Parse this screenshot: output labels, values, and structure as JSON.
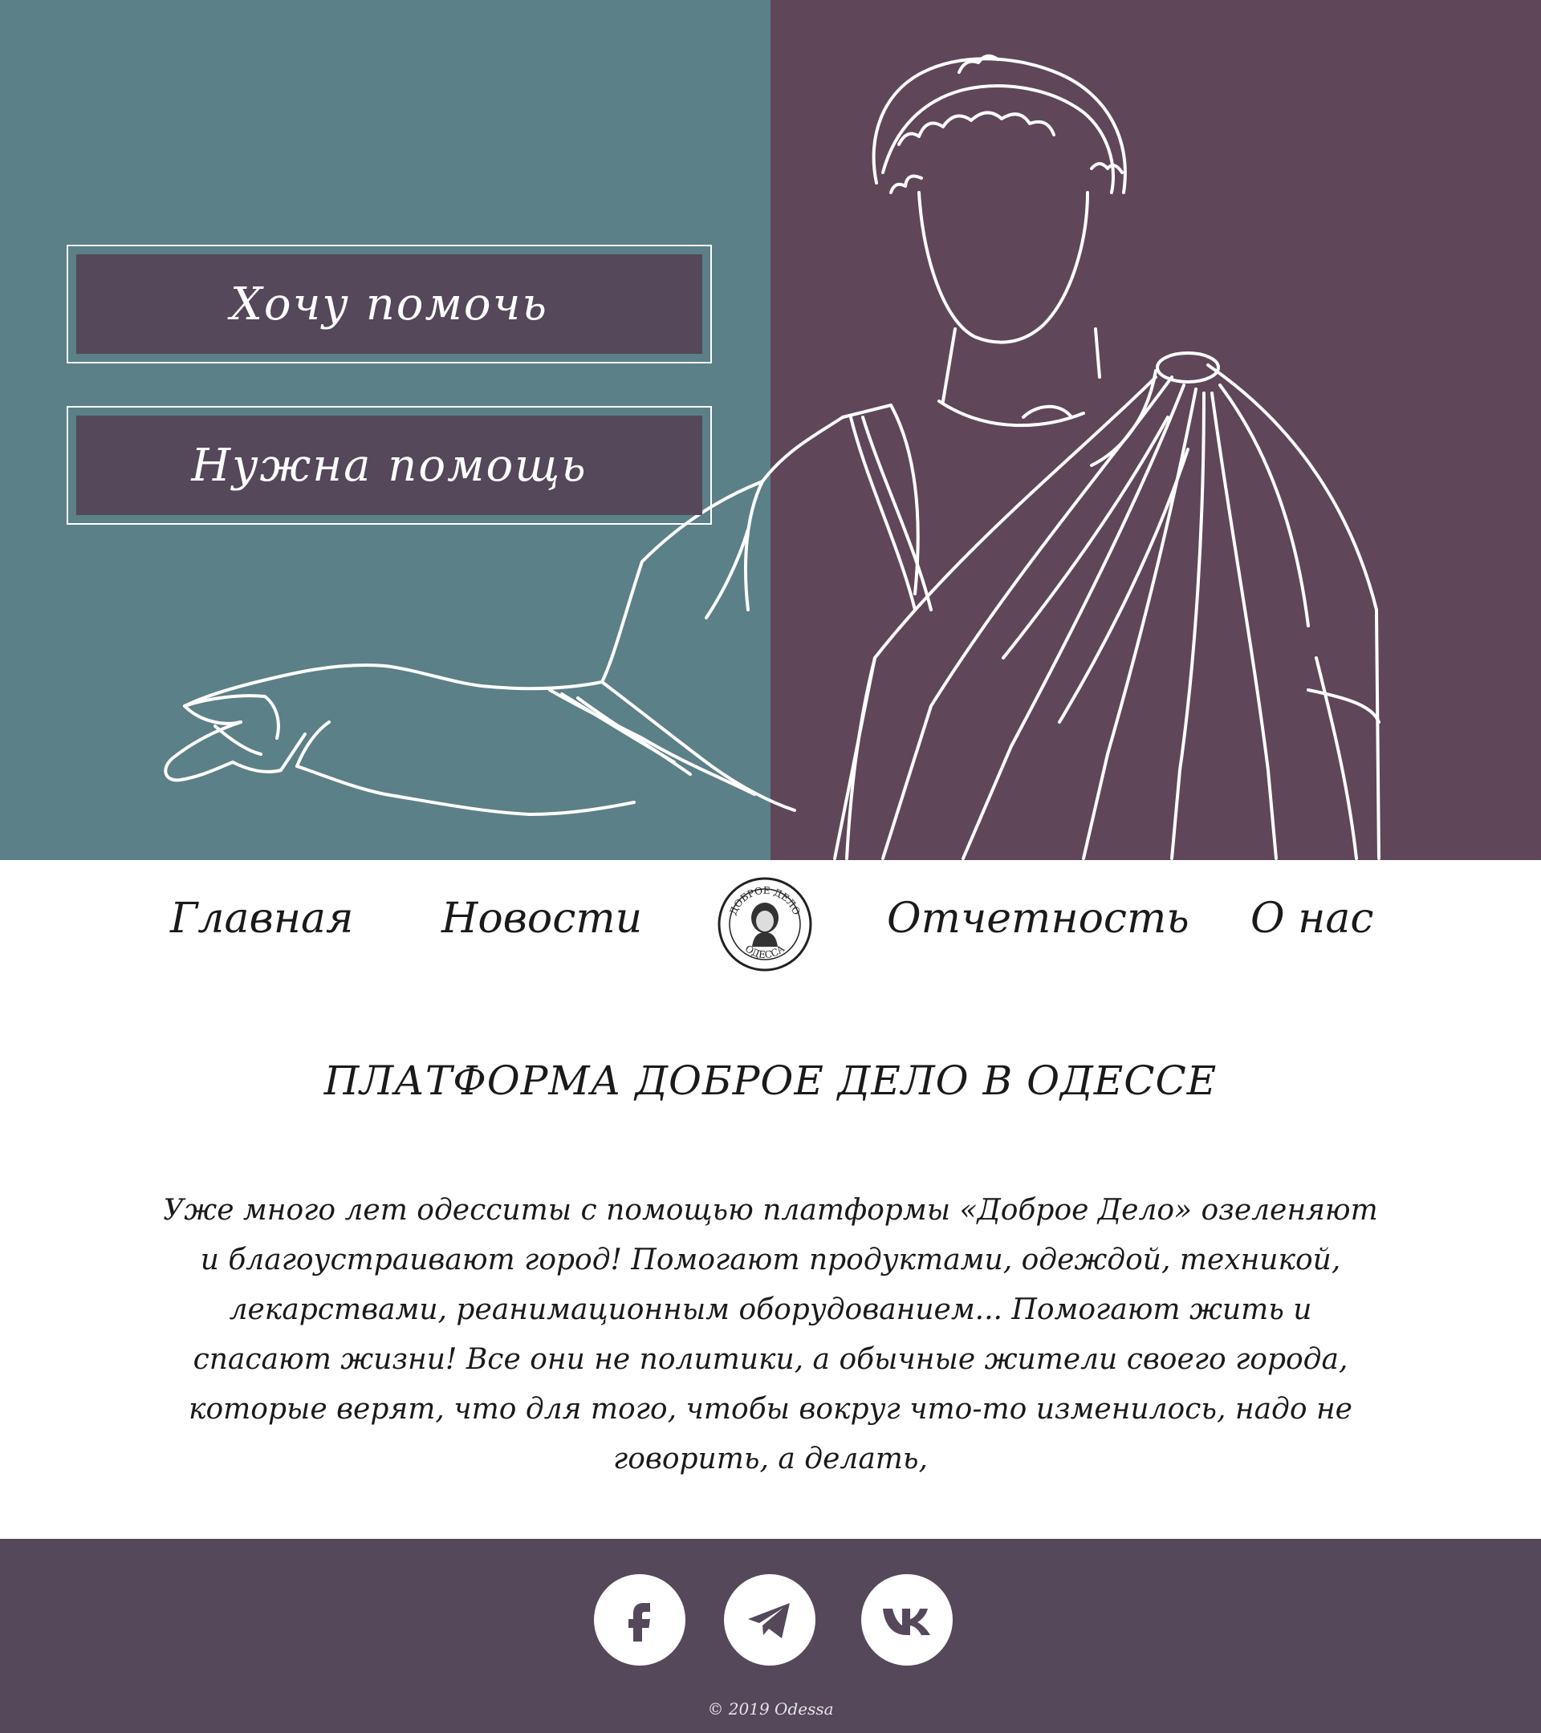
{
  "hero": {
    "cta_want_help": "Хочу помочь",
    "cta_need_help": "Нужна помощь"
  },
  "nav": {
    "items": [
      "Главная",
      "Новости",
      "Отчетность",
      "О нас"
    ],
    "logo": {
      "top_text": "ДОБРОЕ ДЕЛО",
      "bottom_text": "ОДЕССА"
    }
  },
  "main": {
    "title": "ПЛАТФОРМА ДОБРОЕ ДЕЛО В ОДЕССЕ",
    "intro": "Уже много лет одесситы с помощью платформы «Доброе Дело» озеленяют и благоустраивают город! Помогают продуктами, одеждой, техникой, лекарствами, реанимационным оборудованием... Помогают жить и спасают жизни! Все они не политики, а обычные жители своего города, которые верят, что для того, чтобы вокруг что-то изменилось, надо не говорить, а делать,"
  },
  "footer": {
    "social": [
      "facebook-icon",
      "telegram-icon",
      "vk-icon"
    ],
    "copyright": "© 2019 Odessa"
  },
  "colors": {
    "hero_left": "#5b8087",
    "hero_right": "#5f4658",
    "button_fill": "#54485a",
    "footer": "#54485a"
  }
}
